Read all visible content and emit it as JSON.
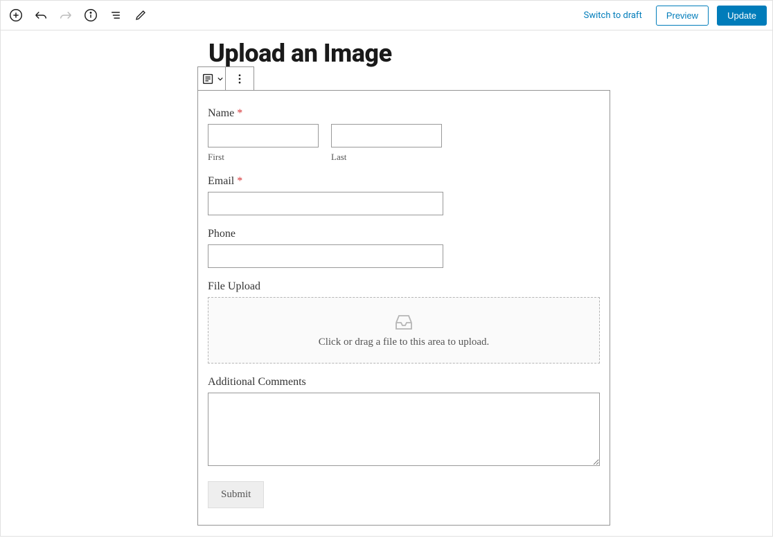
{
  "toolbar": {
    "switch_to_draft": "Switch to draft",
    "preview": "Preview",
    "update": "Update"
  },
  "page": {
    "title": "Upload an Image"
  },
  "form": {
    "name": {
      "label": "Name",
      "required_mark": "*",
      "first_sublabel": "First",
      "last_sublabel": "Last"
    },
    "email": {
      "label": "Email",
      "required_mark": "*"
    },
    "phone": {
      "label": "Phone"
    },
    "file": {
      "label": "File Upload",
      "dropzone_text": "Click or drag a file to this area to upload."
    },
    "comments": {
      "label": "Additional Comments"
    },
    "submit_label": "Submit"
  }
}
